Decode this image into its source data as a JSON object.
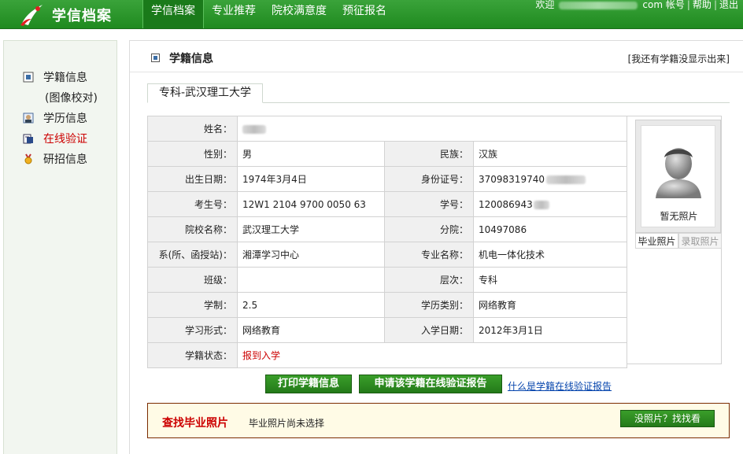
{
  "header": {
    "logo_text": "学信档案",
    "nav": [
      {
        "label": "学信档案",
        "active": true
      },
      {
        "label": "专业推荐",
        "active": false
      },
      {
        "label": "院校满意度",
        "active": false
      },
      {
        "label": "预征报名",
        "active": false
      }
    ],
    "welcome_label": "欢迎",
    "welcome_suffix": "com",
    "account_label": "帐号",
    "help_label": "帮助",
    "logout_label": "退出",
    "separator": "|"
  },
  "sidebar": {
    "items": [
      {
        "label": "学籍信息",
        "icon": "document-icon"
      },
      {
        "label": "学历信息",
        "icon": "graduate-icon"
      },
      {
        "label": "在线验证",
        "icon": "verify-icon",
        "highlight": true
      },
      {
        "label": "研招信息",
        "icon": "medal-icon"
      }
    ],
    "sub_label": "(图像校对)"
  },
  "main": {
    "title": "学籍信息",
    "missing_link": "[我还有学籍没显示出来]",
    "tab_label": "专科-武汉理工大学",
    "fields": {
      "name": {
        "label": "姓名：",
        "value": ""
      },
      "gender": {
        "label": "性别：",
        "value": "男"
      },
      "ethnicity": {
        "label": "民族：",
        "value": "汉族"
      },
      "birth": {
        "label": "出生日期：",
        "value": "1974年3月4日"
      },
      "id_card": {
        "label": "身份证号：",
        "value": "37098319740"
      },
      "exam_no": {
        "label": "考生号：",
        "value": "12W1 2104 9700 0050 63"
      },
      "student_no": {
        "label": "学号：",
        "value": "120086943"
      },
      "school": {
        "label": "院校名称：",
        "value": "武汉理工大学"
      },
      "branch": {
        "label": "分院：",
        "value": "10497086"
      },
      "department": {
        "label": "系(所、函授站)：",
        "value": "湘潭学习中心"
      },
      "major": {
        "label": "专业名称：",
        "value": "机电一体化技术"
      },
      "class": {
        "label": "班级：",
        "value": ""
      },
      "level": {
        "label": "层次：",
        "value": "专科"
      },
      "duration": {
        "label": "学制：",
        "value": "2.5"
      },
      "edu_type": {
        "label": "学历类别：",
        "value": "网络教育"
      },
      "study_form": {
        "label": "学习形式：",
        "value": "网络教育"
      },
      "enroll_date": {
        "label": "入学日期：",
        "value": "2012年3月1日"
      },
      "status": {
        "label": "学籍状态：",
        "value": "报到入学"
      }
    },
    "photo": {
      "placeholder_text": "暂无照片",
      "tab_grad": "毕业照片",
      "tab_admit": "录取照片"
    },
    "buttons": {
      "print": "打印学籍信息",
      "apply_report": "申请该学籍在线验证报告",
      "what_is_report": "什么是学籍在线验证报告"
    },
    "find_photo": {
      "title": "查找毕业照片",
      "message": "毕业照片尚未选择",
      "button": "没照片？找找看"
    }
  },
  "colors": {
    "header_green": "#2a962a",
    "accent_red": "#cc0000",
    "button_green": "#2e8c22",
    "link_blue": "#0645ad"
  }
}
